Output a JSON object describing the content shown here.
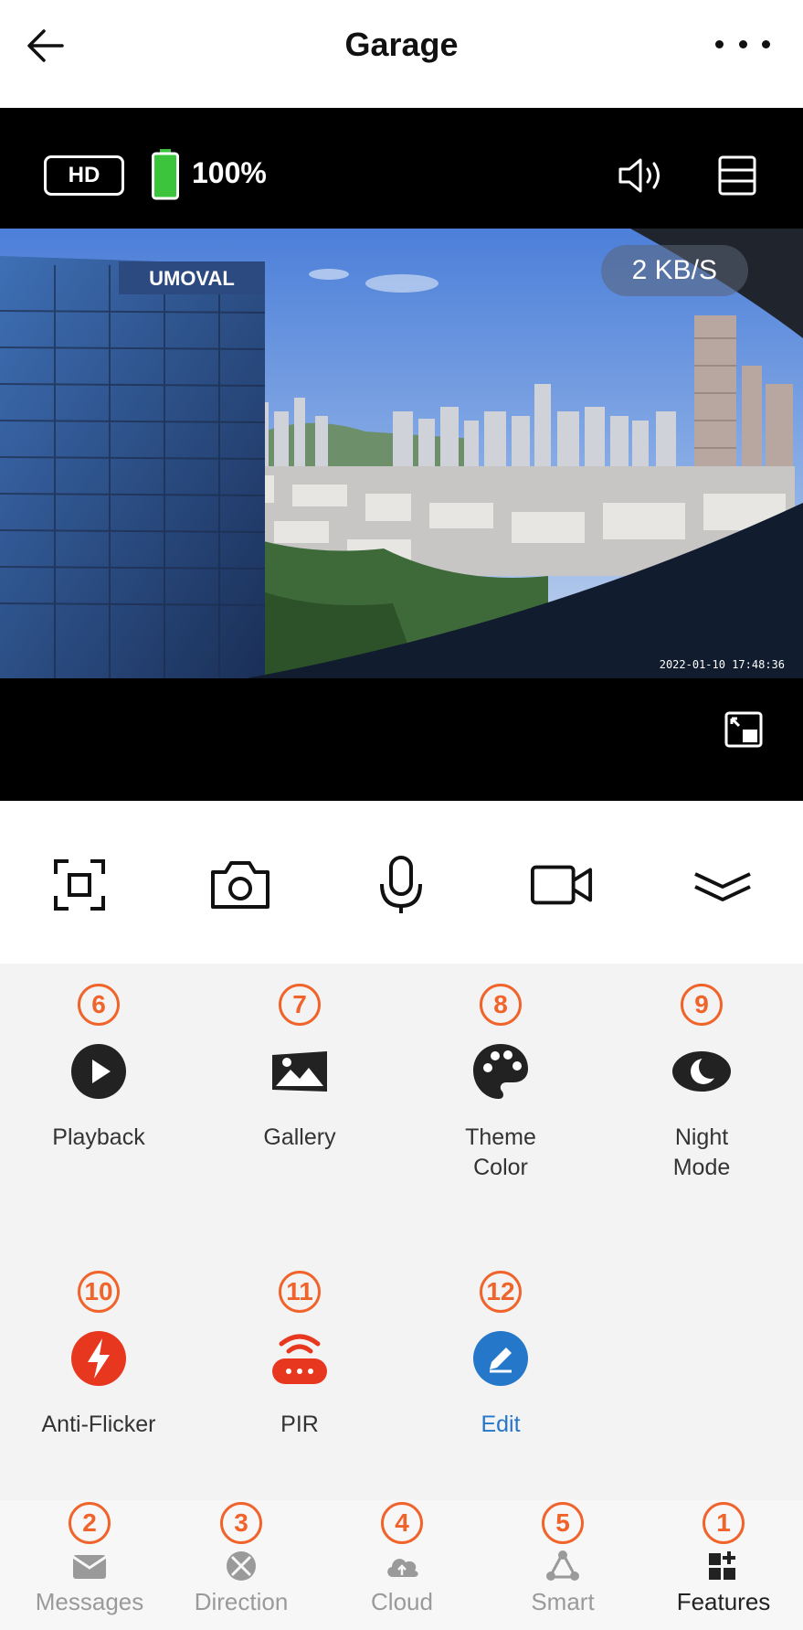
{
  "header": {
    "title": "Garage"
  },
  "video": {
    "quality": "HD",
    "battery": "100%",
    "battery_level": 1.0,
    "data_rate": "2 KB/S",
    "scene_sign": "UMOVAL",
    "timestamp": "2022-01-10 17:48:36"
  },
  "features": [
    {
      "num": "6",
      "label": "Playback",
      "icon": "play-icon"
    },
    {
      "num": "7",
      "label": "Gallery",
      "icon": "gallery-icon"
    },
    {
      "num": "8",
      "label": "Theme\nColor",
      "icon": "palette-icon"
    },
    {
      "num": "9",
      "label": "Night\nMode",
      "icon": "moon-icon"
    },
    {
      "num": "10",
      "label": "Anti-Flicker",
      "icon": "flash-icon"
    },
    {
      "num": "11",
      "label": "PIR",
      "icon": "pir-sensor-icon"
    },
    {
      "num": "12",
      "label": "Edit",
      "icon": "edit-icon"
    }
  ],
  "tabs": [
    {
      "num": "2",
      "label": "Messages",
      "icon": "envelope-icon"
    },
    {
      "num": "3",
      "label": "Direction",
      "icon": "direction-icon"
    },
    {
      "num": "4",
      "label": "Cloud",
      "icon": "cloud-icon"
    },
    {
      "num": "5",
      "label": "Smart",
      "icon": "smart-icon"
    },
    {
      "num": "1",
      "label": "Features",
      "icon": "features-grid-icon"
    }
  ],
  "colors": {
    "accent_badge": "#f0632a",
    "anti_flicker": "#e8371f",
    "pir": "#e8371f",
    "edit": "#2477c9",
    "battery": "#3cc43c"
  }
}
